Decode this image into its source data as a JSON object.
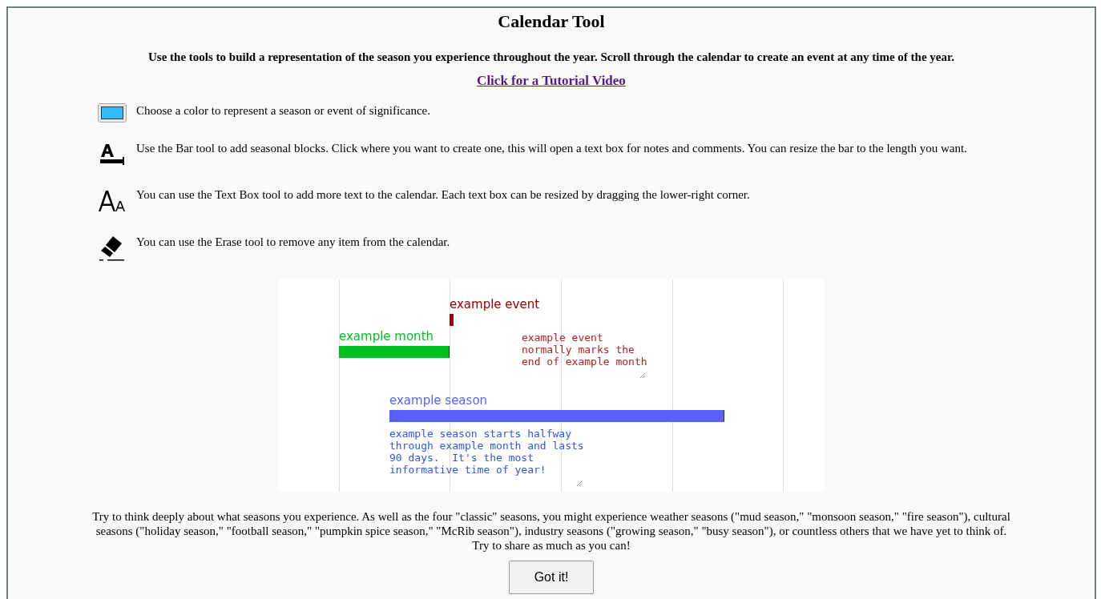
{
  "title": "Calendar Tool",
  "intro": "Use the tools to build a representation of the season you experience throughout the year. Scroll through the calendar to create an event at any time of the year.",
  "tutorial_link": "Click for a Tutorial Video",
  "tools": [
    {
      "kind": "color",
      "color": "#33bbff",
      "text": "Choose a color to represent a season or event of significance."
    },
    {
      "kind": "bar",
      "text": "Use the Bar tool to add seasonal blocks. Click where you want to create one, this will open a text box for notes and comments. You can resize the bar to the length you want."
    },
    {
      "kind": "text",
      "text": "You can use the Text Box tool to add more text to the calendar. Each text box can be resized by dragging the lower-right corner."
    },
    {
      "kind": "erase",
      "text": "You can use the Erase tool to remove any item from the calendar."
    }
  ],
  "example": {
    "items": [
      {
        "kind": "bar",
        "label": "example event",
        "color": "#a00000"
      },
      {
        "kind": "bar",
        "label": "example month",
        "color": "#00c020"
      },
      {
        "kind": "note",
        "text": "example event\nnormally marks the\nend of example month",
        "color": "#b22222"
      },
      {
        "kind": "bar",
        "label": "example season",
        "color": "#5a5fff"
      },
      {
        "kind": "note",
        "text": "example season starts halfway\nthrough example month and lasts\n90 days.  It's the most\ninformative time of year!",
        "color": "#3355dd"
      }
    ]
  },
  "closing": "Try to think deeply about what seasons you experience. As well as the four \"classic\" seasons, you might experience weather seasons (\"mud season,\" \"monsoon season,\" \"fire season\"), cultural seasons (\"holiday season,\" \"football season,\" \"pumpkin spice season,\" \"McRib season\"), industry seasons (\"growing season,\" \"busy season\"), or countless others that we have yet to think of. Try to share as much as you can!",
  "button": "Got it!"
}
